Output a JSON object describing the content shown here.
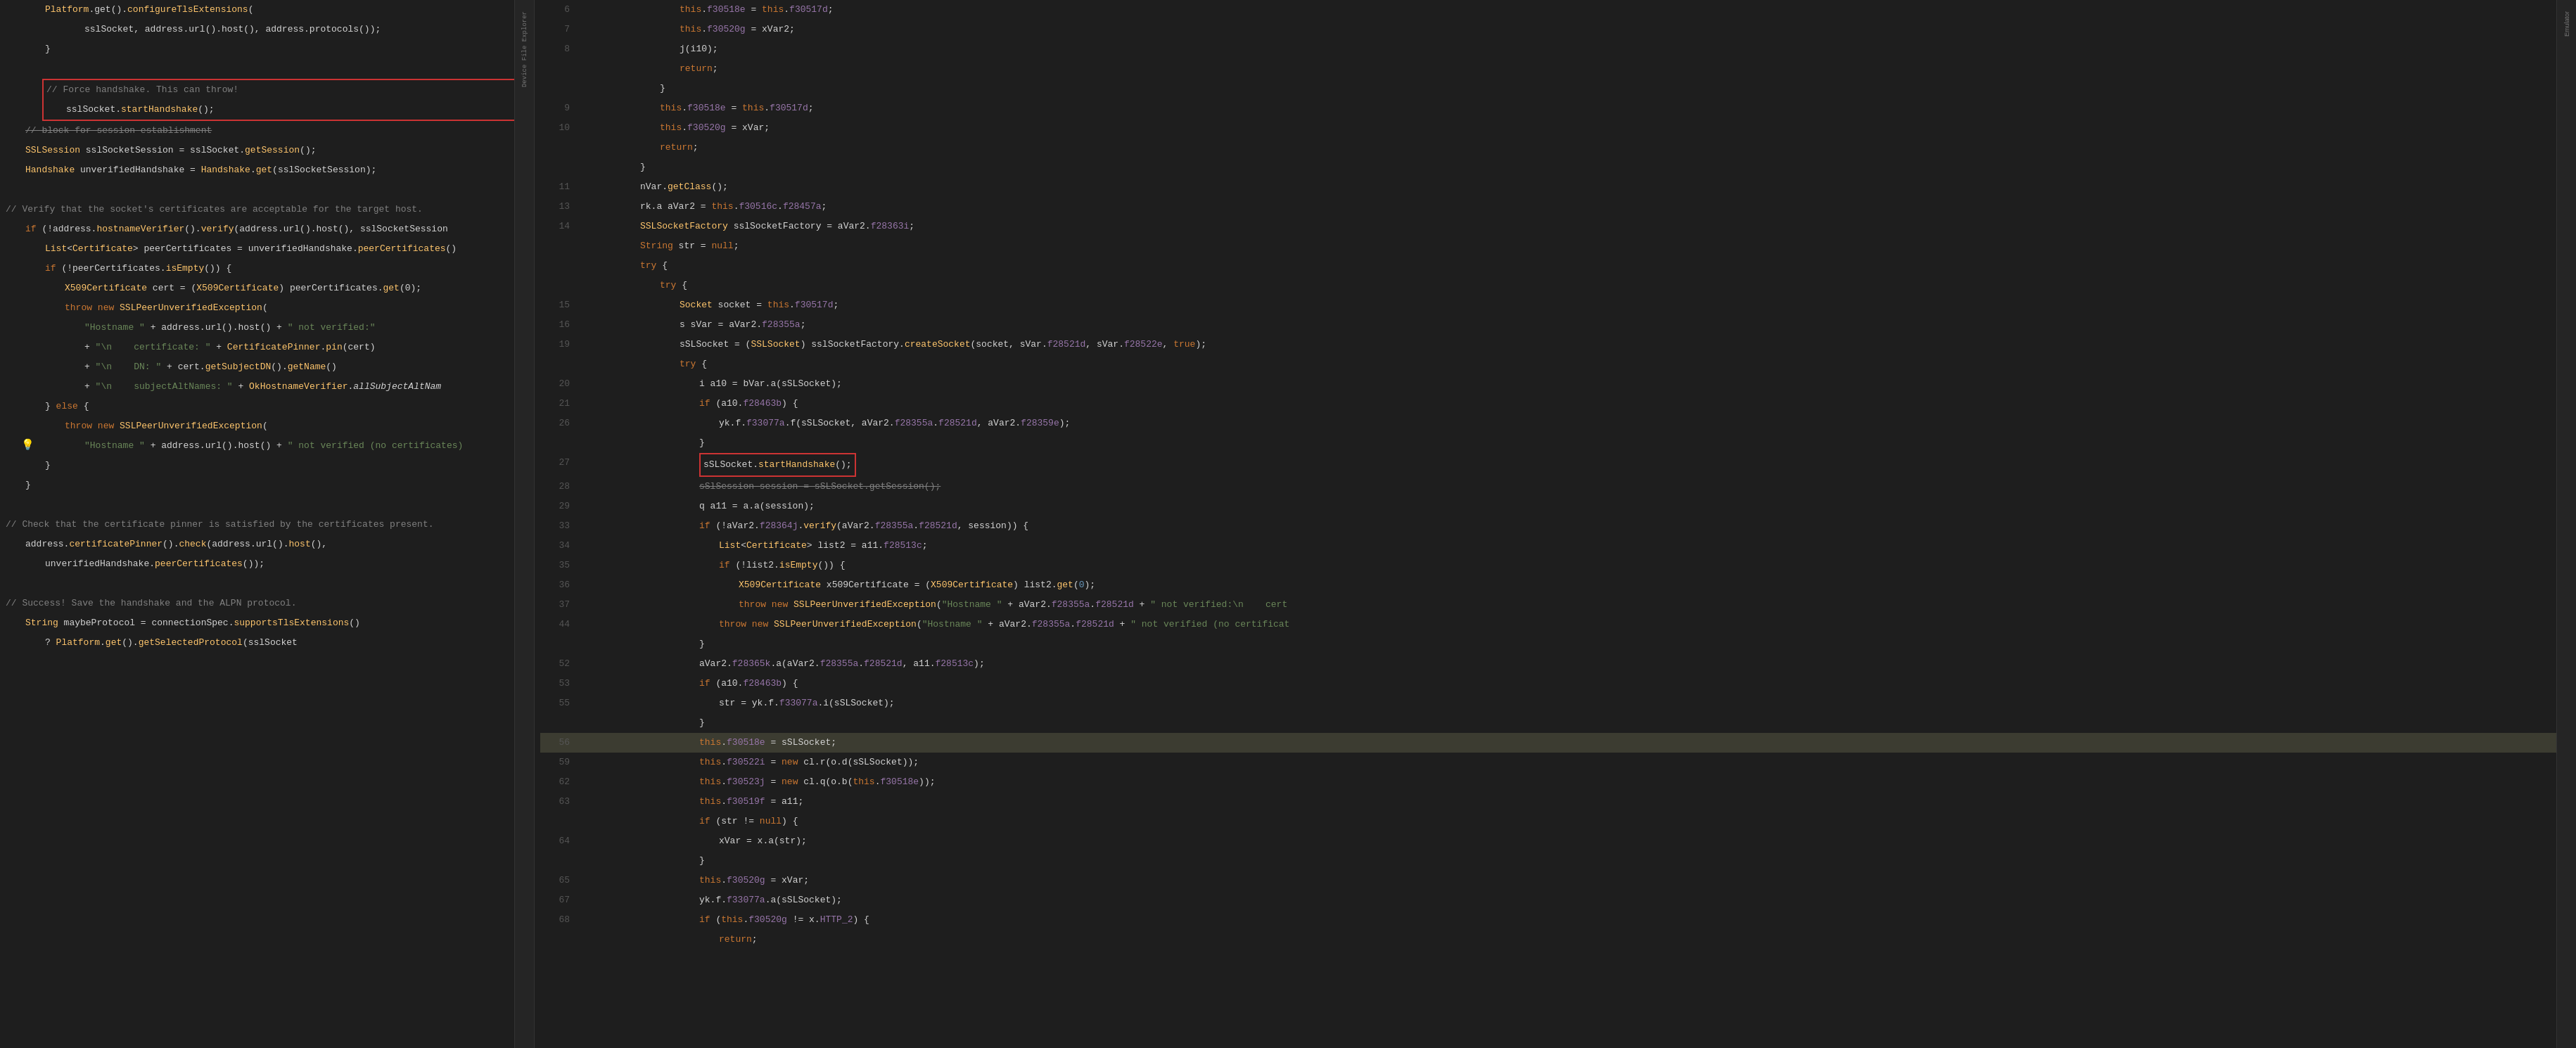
{
  "left": {
    "lines": [
      {
        "content": "Platform.get().configureTlsExtensions(",
        "indent": 2
      },
      {
        "content": "sslSocket, address.url().host(), address.protocols());",
        "indent": 3
      },
      {
        "content": "}",
        "indent": 2
      },
      {
        "content": ""
      },
      {
        "content": "// Force handshake. This can throw!",
        "type": "comment",
        "redbox_start": true
      },
      {
        "content": "sslSocket.startHandshake();",
        "indent": 2,
        "redbox": true
      },
      {
        "content": "// block for session establishment",
        "type": "comment",
        "strikethrough": true
      },
      {
        "content": "SSLSession sslSocketSession = sslSocket.getSession();",
        "indent": 2
      },
      {
        "content": "Handshake unverifiedHandshake = Handshake.get(sslSocketSession);",
        "indent": 2
      },
      {
        "content": ""
      },
      {
        "content": "// Verify that the socket's certificates are acceptable for the target host.",
        "type": "comment"
      },
      {
        "content": "if (!address.hostnameVerifier().verify(address.url().host(), sslSocketSession",
        "indent": 2
      },
      {
        "content": "List<Certificate> peerCertificates = unverifiedHandshake.peerCertificates()",
        "indent": 3
      },
      {
        "content": "if (!peerCertificates.isEmpty()) {",
        "indent": 3
      },
      {
        "content": "X509Certificate cert = (X509Certificate) peerCertificates.get(0);",
        "indent": 4
      },
      {
        "content": "throw new SSLPeerUnverifiedException(",
        "indent": 4
      },
      {
        "content": "\"Hostname \" + address.url().host() + \" not verified:\"",
        "indent": 5
      },
      {
        "content": "+ \"\\n    certificate: \" + CertificatePinner.pin(cert)",
        "indent": 5
      },
      {
        "content": "+ \"\\n    DN: \" + cert.getSubjectDN().getName()",
        "indent": 5
      },
      {
        "content": "+ \"\\n    subjectAltNames: \" + OkHostnameVerifier.allSubjectAltNam",
        "indent": 5
      },
      {
        "content": "} else {",
        "indent": 3
      },
      {
        "content": "throw new SSLPeerUnverifiedException(",
        "indent": 4
      },
      {
        "content": "\"Hostname \" + address.url().host() + \" not verified (no certificates)",
        "indent": 5,
        "lightbulb": true
      },
      {
        "content": "}",
        "indent": 3
      },
      {
        "content": "}",
        "indent": 2
      },
      {
        "content": ""
      },
      {
        "content": "// Check that the certificate pinner is satisfied by the certificates present.",
        "type": "comment"
      },
      {
        "content": "address.certificatePinner().check(address.url().host(),",
        "indent": 2
      },
      {
        "content": "unverifiedHandshake.peerCertificates());",
        "indent": 3
      },
      {
        "content": ""
      },
      {
        "content": "// Success! Save the handshake and the ALPN protocol.",
        "type": "comment"
      },
      {
        "content": "String maybeProtocol = connectionSpec.supportsTlsExtensions()",
        "indent": 2
      },
      {
        "content": "? Platform.get().getSelectedProtocol(sslSocket",
        "indent": 3
      }
    ]
  },
  "right": {
    "lines": [
      {
        "num": 6,
        "content": "this.f30518e = this.f30517d;"
      },
      {
        "num": 7,
        "content": "this.f30520g = xVar2;"
      },
      {
        "num": 8,
        "content": "j(i10);"
      },
      {
        "num": "",
        "content": "return;"
      },
      {
        "num": "",
        "content": "}"
      },
      {
        "num": 9,
        "content": "this.f30518e = this.f30517d;"
      },
      {
        "num": 10,
        "content": "this.f30520g = xVar;"
      },
      {
        "num": "",
        "content": "return;"
      },
      {
        "num": "",
        "content": "}"
      },
      {
        "num": 11,
        "content": "nVar.getClass();"
      },
      {
        "num": 13,
        "content": "rk.a aVar2 = this.f30516c.f28457a;"
      },
      {
        "num": 14,
        "content": "SSLSocketFactory sslSocketFactory = aVar2.f28363i;"
      },
      {
        "num": "",
        "content": "String str = null;"
      },
      {
        "num": "",
        "content": "try {"
      },
      {
        "num": "",
        "content": "try {"
      },
      {
        "num": 15,
        "content": "Socket socket = this.f30517d;"
      },
      {
        "num": 16,
        "content": "s sVar = aVar2.f28355a;"
      },
      {
        "num": 19,
        "content": "sSLSocket = (SSLSocket) sslSocketFactory.createSocket(socket, sVar.f28521d, sVar.f28522e, true);"
      },
      {
        "num": "",
        "content": "try {"
      },
      {
        "num": 20,
        "content": "i a10 = bVar.a(sSLSocket);"
      },
      {
        "num": 21,
        "content": "if (a10.f28463b) {"
      },
      {
        "num": 26,
        "content": "yk.f.f33077a.f(sSLSocket, aVar2.f28355a.f28521d, aVar2.f28359e);"
      },
      {
        "num": "",
        "content": "}"
      },
      {
        "num": 27,
        "content": "sSlSocket.startHandshake();",
        "redbox": true
      },
      {
        "num": 28,
        "content": "sSlSession session = sSLSocket.getSession();",
        "strikethrough": true
      },
      {
        "num": 29,
        "content": "q a11 = a.a(session);"
      },
      {
        "num": 33,
        "content": "if (!aVar2.f28364j.verify(aVar2.f28355a.f28521d, session)) {"
      },
      {
        "num": 34,
        "content": "List<Certificate> list2 = a11.f28513c;"
      },
      {
        "num": 35,
        "content": "if (!list2.isEmpty()) {"
      },
      {
        "num": 36,
        "content": "X509Certificate x509Certificate = (X509Certificate) list2.get(0);"
      },
      {
        "num": 37,
        "content": "throw new SSLPeerUnverifiedException(\"Hostname \" + aVar2.f28355a.f28521d + \" not verified:\\n    cert"
      },
      {
        "num": 44,
        "content": "throw new SSLPeerUnverifiedException(\"Hostname \" + aVar2.f28355a.f28521d + \" not verified (no certificat"
      },
      {
        "num": "",
        "content": "}"
      },
      {
        "num": 52,
        "content": "aVar2.f28365k.a(aVar2.f28355a.f28521d, a11.f28513c);"
      },
      {
        "num": 53,
        "content": "if (a10.f28463b) {"
      },
      {
        "num": 55,
        "content": "str = yk.f.f33077a.i(sSLSocket);"
      },
      {
        "num": "",
        "content": "}"
      },
      {
        "num": 56,
        "content": "this.f30518e = sSLSocket;",
        "highlighted": true
      },
      {
        "num": 59,
        "content": "this.f30522i = new cl.r(o.d(sSLSocket));"
      },
      {
        "num": 62,
        "content": "this.f30523j = new cl.q(o.b(this.f30518e));"
      },
      {
        "num": 63,
        "content": "this.f30519f = a11;"
      },
      {
        "num": "",
        "content": "if (str != null) {"
      },
      {
        "num": 64,
        "content": "xVar = x.a(str);"
      },
      {
        "num": "",
        "content": "}"
      },
      {
        "num": 65,
        "content": "this.f30520g = xVar;"
      },
      {
        "num": 67,
        "content": "yk.f.f33077a.a(sSLSocket);"
      },
      {
        "num": 68,
        "content": "if (this.f30520g != x.HTTP_2) {"
      },
      {
        "num": "",
        "content": "return;"
      }
    ]
  },
  "sidebar": {
    "device_file_explorer": "Device File Explorer",
    "emulator": "Emulator"
  }
}
